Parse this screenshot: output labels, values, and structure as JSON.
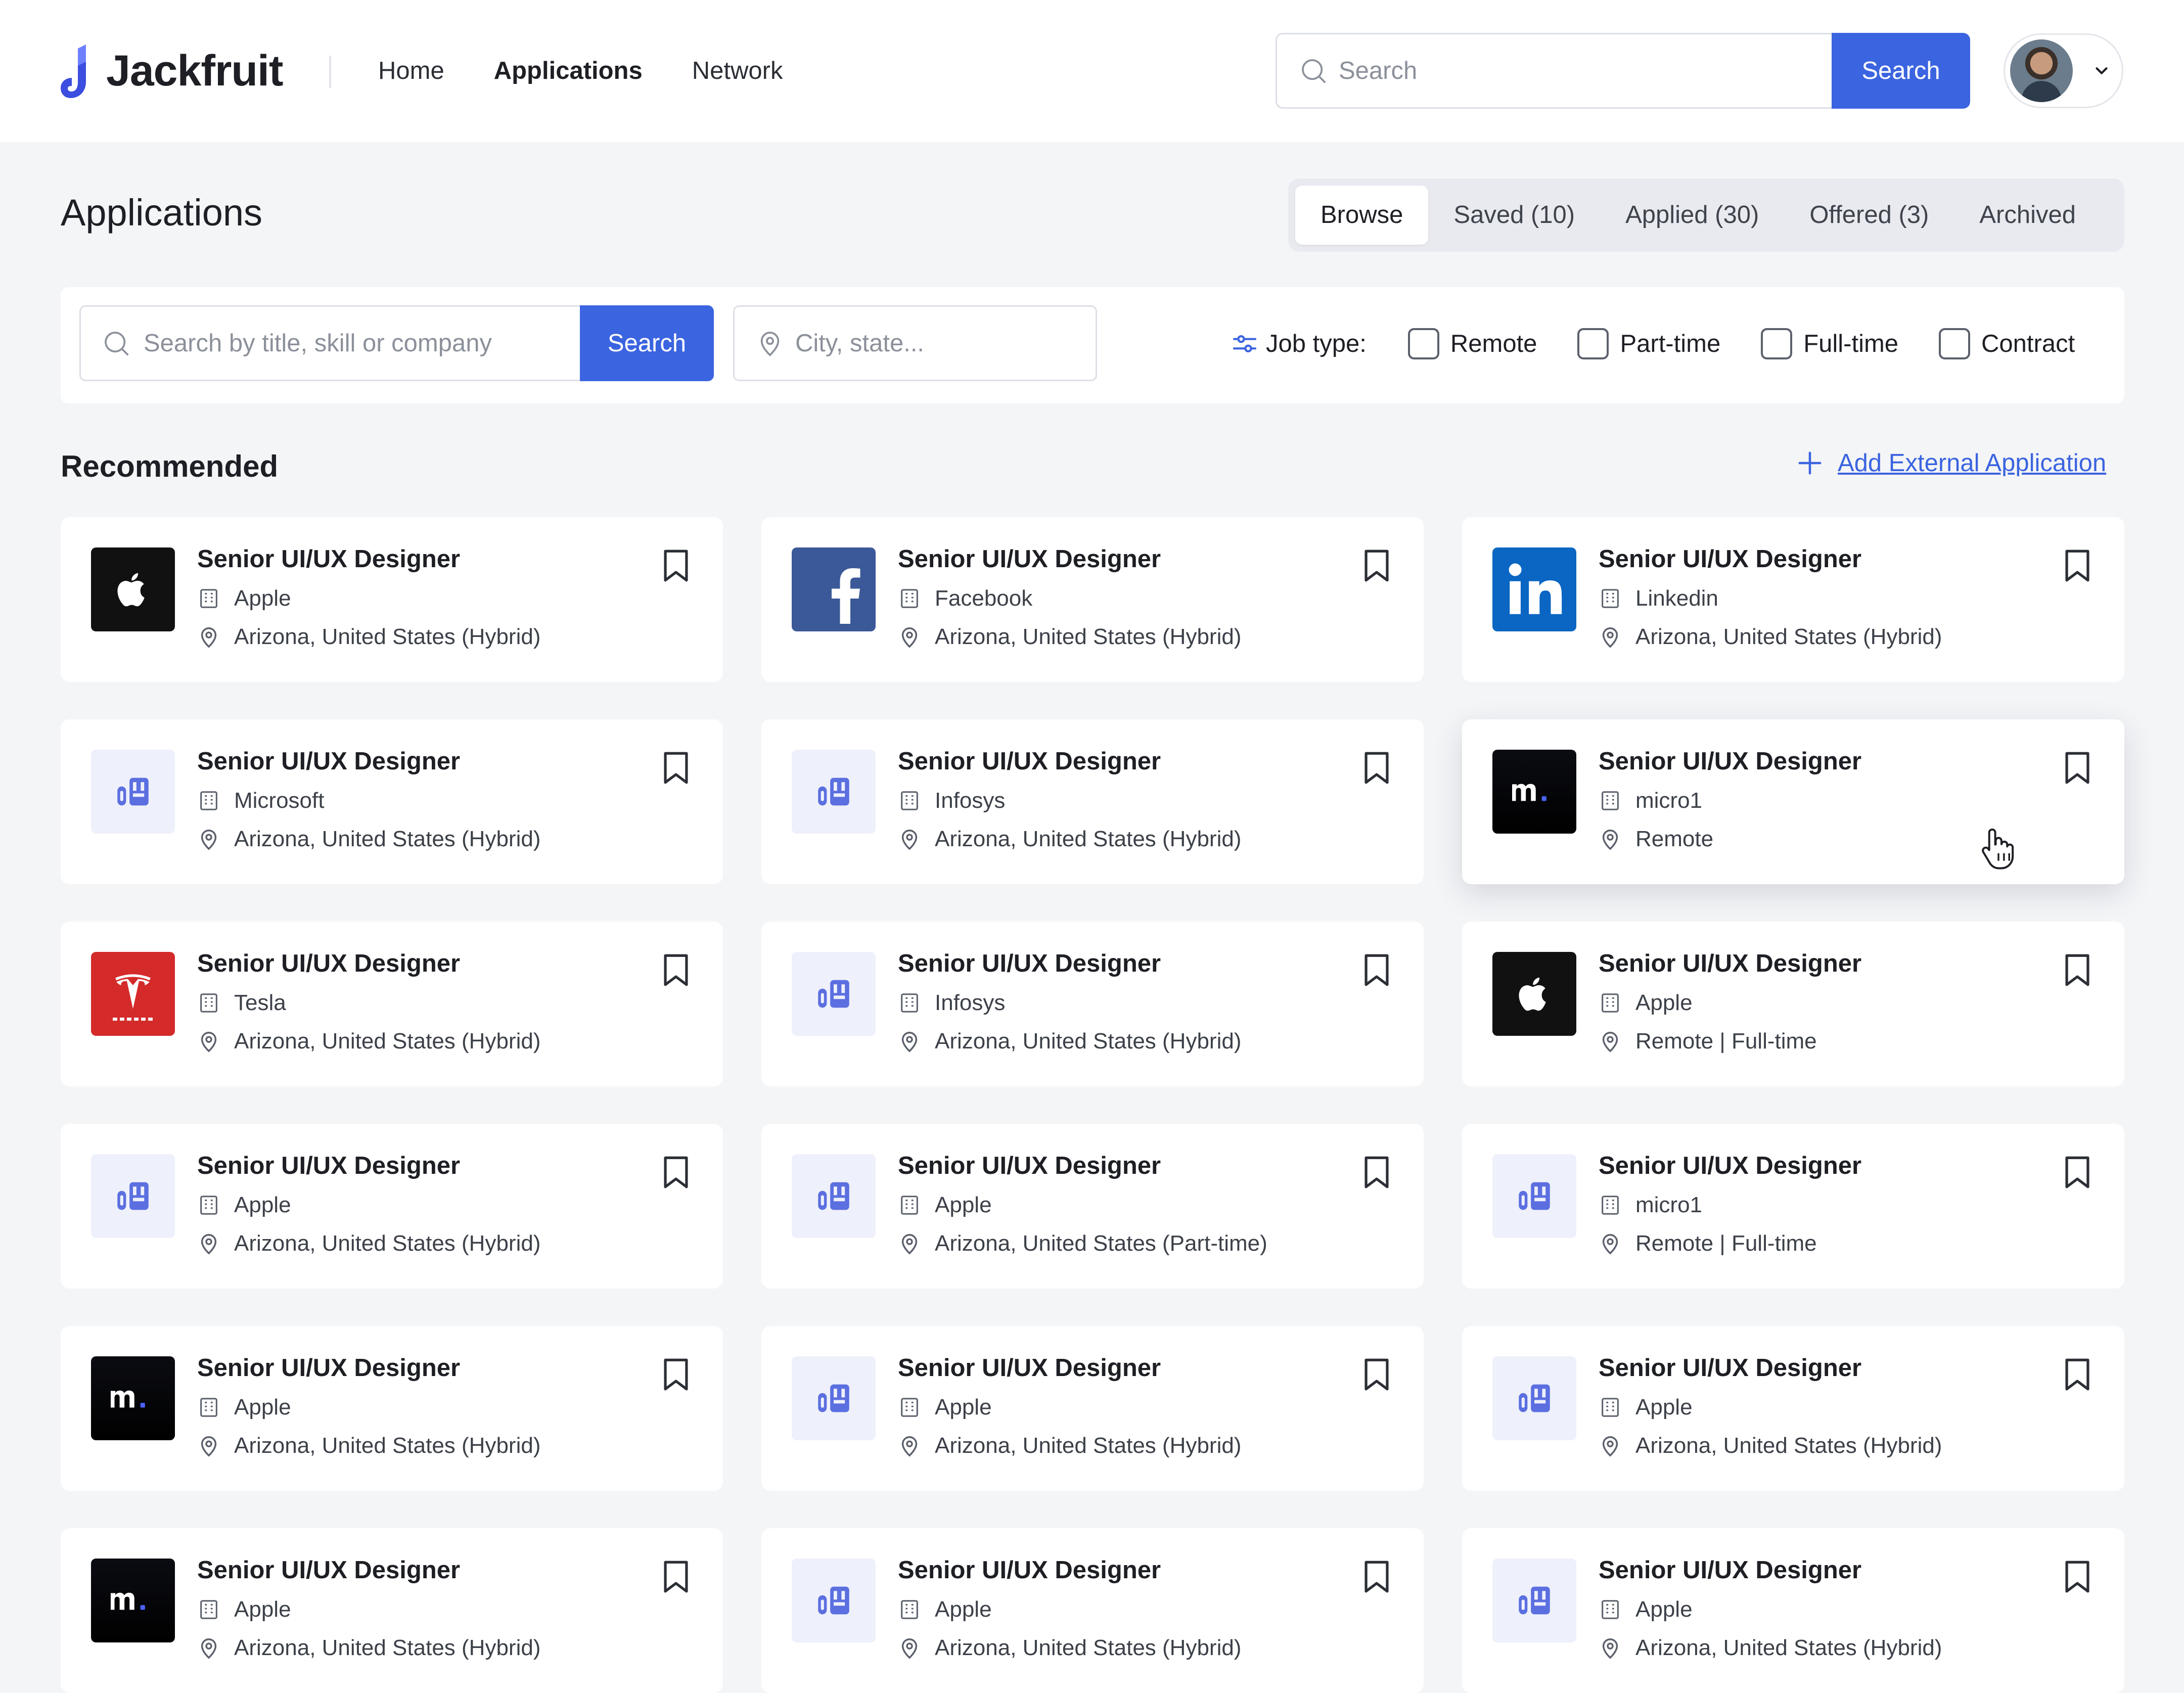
{
  "brand": {
    "name": "Jackfruit",
    "accent": "#3b64e0"
  },
  "nav": {
    "items": [
      "Home",
      "Applications",
      "Network"
    ],
    "active": "Applications"
  },
  "top_search": {
    "placeholder": "Search",
    "button": "Search"
  },
  "page": {
    "title": "Applications"
  },
  "tabs": [
    "Browse",
    "Saved (10)",
    "Applied (30)",
    "Offered (3)",
    "Archived"
  ],
  "filters": {
    "search_placeholder": "Search by title, skill or company",
    "search_button": "Search",
    "city_placeholder": "City, state...",
    "job_type_label": "Job type:",
    "options": [
      "Remote",
      "Part-time",
      "Full-time",
      "Contract"
    ]
  },
  "section": {
    "title": "Recommended",
    "add_external": "Add External Application"
  },
  "jobs": [
    {
      "title": "Senior UI/UX Designer",
      "company": "Apple",
      "location": "Arizona, United States (Hybrid)",
      "logo": "apple-logo"
    },
    {
      "title": "Senior UI/UX Designer",
      "company": "Facebook",
      "location": "Arizona, United States (Hybrid)",
      "logo": "facebook-logo"
    },
    {
      "title": "Senior UI/UX Designer",
      "company": "Linkedin",
      "location": "Arizona, United States (Hybrid)",
      "logo": "linkedin-logo"
    },
    {
      "title": "Senior UI/UX Designer",
      "company": "Microsoft",
      "location": "Arizona, United States (Hybrid)",
      "logo": "building-placeholder-logo"
    },
    {
      "title": "Senior UI/UX Designer",
      "company": "Infosys",
      "location": "Arizona, United States (Hybrid)",
      "logo": "building-placeholder-logo"
    },
    {
      "title": "Senior UI/UX Designer",
      "company": "micro1",
      "location": "Remote",
      "logo": "micro1-logo"
    },
    {
      "title": "Senior UI/UX Designer",
      "company": "Tesla",
      "location": "Arizona, United States (Hybrid)",
      "logo": "tesla-logo"
    },
    {
      "title": "Senior UI/UX Designer",
      "company": "Infosys",
      "location": "Arizona, United States (Hybrid)",
      "logo": "building-placeholder-logo"
    },
    {
      "title": "Senior UI/UX Designer",
      "company": "Apple",
      "location": "Remote | Full-time",
      "logo": "apple-logo"
    },
    {
      "title": "Senior UI/UX Designer",
      "company": "Apple",
      "location": "Arizona, United States (Hybrid)",
      "logo": "building-placeholder-logo"
    },
    {
      "title": "Senior UI/UX Designer",
      "company": "Apple",
      "location": "Arizona, United States (Part-time)",
      "logo": "building-placeholder-logo"
    },
    {
      "title": "Senior UI/UX Designer",
      "company": "micro1",
      "location": "Remote | Full-time",
      "logo": "building-placeholder-logo"
    },
    {
      "title": "Senior UI/UX Designer",
      "company": "Apple",
      "location": "Arizona, United States (Hybrid)",
      "logo": "micro1-logo"
    },
    {
      "title": "Senior UI/UX Designer",
      "company": "Apple",
      "location": "Arizona, United States (Hybrid)",
      "logo": "building-placeholder-logo"
    },
    {
      "title": "Senior UI/UX Designer",
      "company": "Apple",
      "location": "Arizona, United States (Hybrid)",
      "logo": "building-placeholder-logo"
    },
    {
      "title": "Senior UI/UX Designer",
      "company": "Apple",
      "location": "Arizona, United States (Hybrid)",
      "logo": "micro1-logo"
    },
    {
      "title": "Senior UI/UX Designer",
      "company": "Apple",
      "location": "Arizona, United States (Hybrid)",
      "logo": "building-placeholder-logo"
    },
    {
      "title": "Senior UI/UX Designer",
      "company": "Apple",
      "location": "Arizona, United States (Hybrid)",
      "logo": "building-placeholder-logo"
    }
  ]
}
